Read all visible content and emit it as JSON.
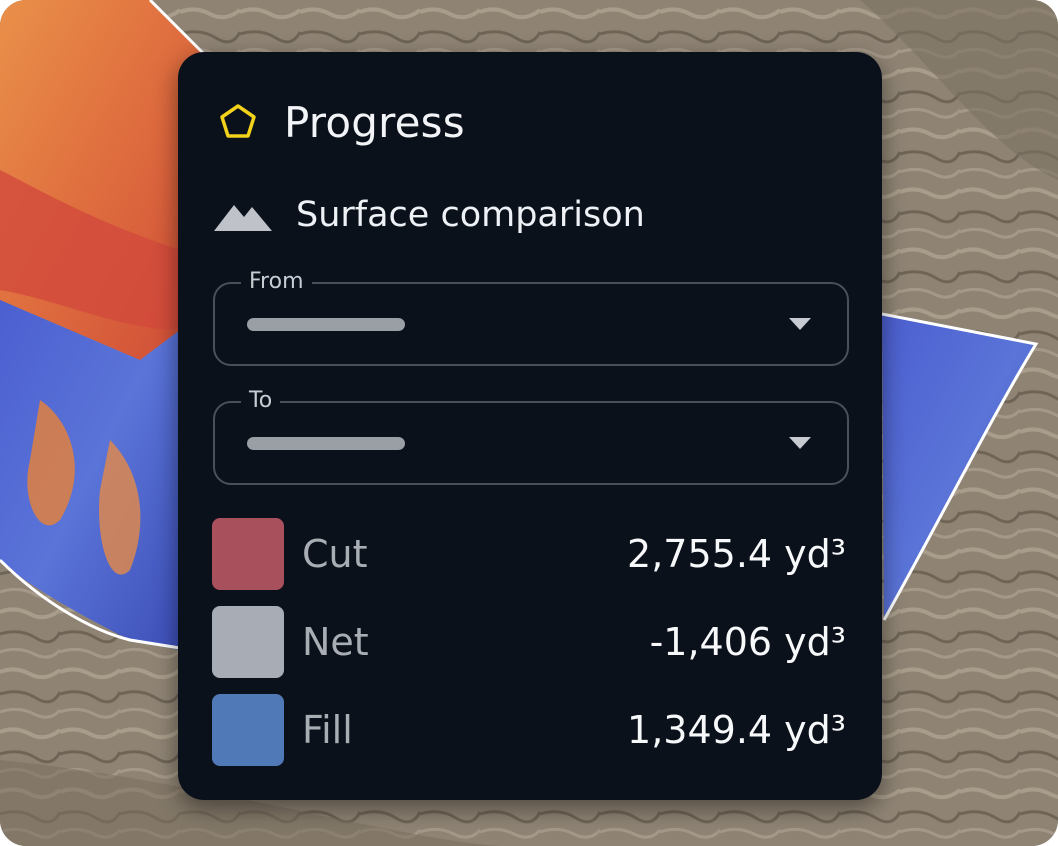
{
  "panel": {
    "title": "Progress",
    "header_icon": "pentagon-outline-icon",
    "accent_color": "#f2d21b"
  },
  "section": {
    "title": "Surface comparison",
    "icon": "mountains-icon"
  },
  "from_select": {
    "label": "From",
    "value_state": "placeholder-redacted"
  },
  "to_select": {
    "label": "To",
    "value_state": "placeholder-redacted"
  },
  "legend": [
    {
      "label": "Cut",
      "value": "2,755.4 yd³",
      "color": "#a8505b"
    },
    {
      "label": "Net",
      "value": "-1,406 yd³",
      "color": "#a8acb4"
    },
    {
      "label": "Fill",
      "value": "1,349.4 yd³",
      "color": "#5079b8"
    }
  ]
}
